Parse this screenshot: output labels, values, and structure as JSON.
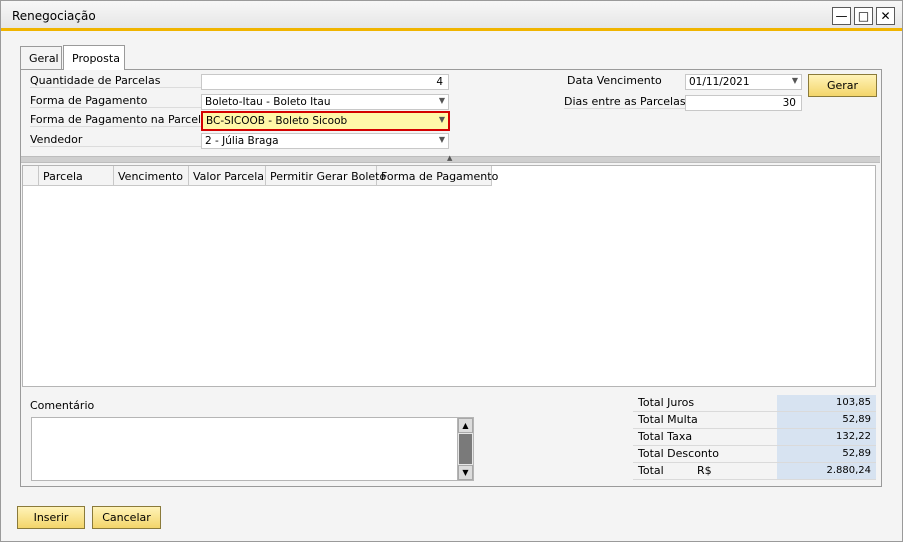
{
  "window": {
    "title": "Renegociação"
  },
  "tabs": [
    {
      "label": "Geral"
    },
    {
      "label": "Proposta"
    }
  ],
  "form": {
    "quantidade_label": "Quantidade de Parcelas",
    "quantidade_value": "4",
    "forma_pagamento_label": "Forma de Pagamento",
    "forma_pagamento_value": "Boleto-Itau     - Boleto Itau",
    "forma_parcela_label": "Forma de Pagamento na Parcela",
    "forma_parcela_value": "BC-SICOOB        - Boleto Sicoob",
    "vendedor_label": "Vendedor",
    "vendedor_value": "2              - Júlia Braga",
    "data_vencimento_label": "Data Vencimento",
    "data_vencimento_value": "01/11/2021",
    "dias_label": "Dias entre as Parcelas",
    "dias_value": "30",
    "gerar_label": "Gerar"
  },
  "grid": {
    "columns": [
      "Parcela",
      "Vencimento",
      "Valor Parcela",
      "Permitir Gerar Boleto",
      "Forma de Pagamento"
    ],
    "rows": []
  },
  "comentario": {
    "label": "Comentário",
    "value": ""
  },
  "totals": [
    {
      "label": "Total  Juros",
      "value": "103,85"
    },
    {
      "label": "Total Multa",
      "value": "52,89"
    },
    {
      "label": "Total Taxa",
      "value": "132,22"
    },
    {
      "label": "Total Desconto",
      "value": "52,89"
    },
    {
      "label": "Total",
      "currency": "R$",
      "value": "2.880,24"
    }
  ],
  "buttons": {
    "inserir": "Inserir",
    "cancelar": "Cancelar"
  },
  "colors": {
    "accent": "#f0b400",
    "highlight_border": "#d40000",
    "highlight_fill": "#fff7a8",
    "button_fill": "#f3d56a",
    "total_fill": "#d7e3f1"
  }
}
